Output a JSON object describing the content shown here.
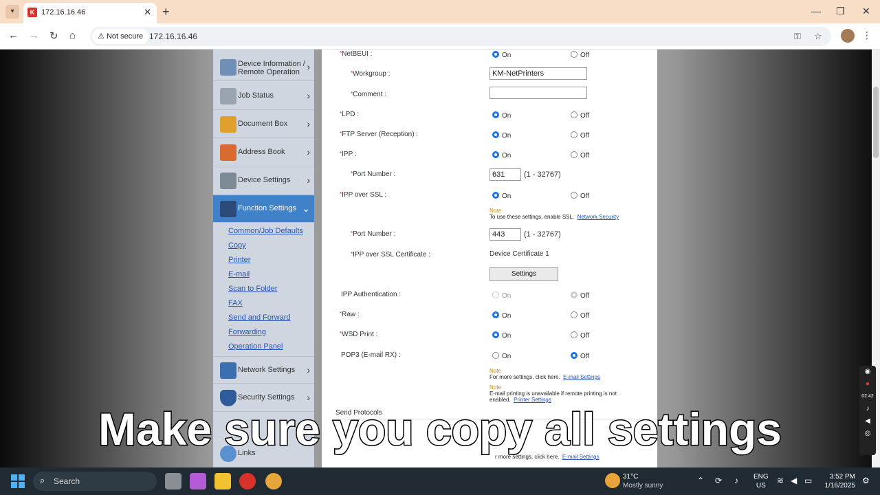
{
  "browser": {
    "tab_title": "172.16.16.46",
    "security_label": "Not secure",
    "url": "172.16.16.46"
  },
  "sidebar": {
    "items": [
      {
        "label_line1": "Device Information /",
        "label_line2": "Remote Operation",
        "icon": "device-info-icon"
      },
      {
        "label": "Job Status",
        "icon": "job-status-icon"
      },
      {
        "label": "Document Box",
        "icon": "document-box-icon"
      },
      {
        "label": "Address Book",
        "icon": "address-book-icon"
      },
      {
        "label": "Device Settings",
        "icon": "device-settings-icon"
      },
      {
        "label": "Function Settings",
        "icon": "function-settings-icon",
        "active": true
      },
      {
        "label": "Network Settings",
        "icon": "network-settings-icon"
      },
      {
        "label": "Security Settings",
        "icon": "security-settings-icon"
      },
      {
        "label": "Links",
        "icon": "links-icon"
      }
    ],
    "sub_items": [
      "Common/Job Defaults",
      "Copy",
      "Printer",
      "E-mail",
      "Scan to Folder",
      "FAX",
      "Send and Forward",
      "Forwarding",
      "Operation Panel"
    ]
  },
  "form": {
    "netbeui": {
      "label": "NetBEUI :",
      "on": "On",
      "off": "Off",
      "value": "On"
    },
    "workgroup": {
      "label": "Workgroup :",
      "value": "KM-NetPrinters"
    },
    "comment": {
      "label": "Comment :",
      "value": ""
    },
    "lpd": {
      "label": "LPD :",
      "on": "On",
      "off": "Off",
      "value": "On"
    },
    "ftp": {
      "label": "FTP Server (Reception) :",
      "on": "On",
      "off": "Off",
      "value": "On"
    },
    "ipp": {
      "label": "IPP :",
      "on": "On",
      "off": "Off",
      "value": "On"
    },
    "ipp_port": {
      "label": "Port Number :",
      "value": "631",
      "range": "(1 - 32767)"
    },
    "ipp_ssl": {
      "label": "IPP over SSL :",
      "on": "On",
      "off": "Off",
      "value": "On"
    },
    "ssl_note": {
      "heading": "Note",
      "text": "To use these settings, enable SSL.",
      "link": "Network Security"
    },
    "ssl_port": {
      "label": "Port Number :",
      "value": "443",
      "range": "(1 - 32767)"
    },
    "ssl_cert": {
      "label": "IPP over SSL Certificate :",
      "value": "Device Certificate 1",
      "button": "Settings"
    },
    "ipp_auth": {
      "label": "IPP Authentication :",
      "on": "On",
      "off": "Off",
      "value": "Off"
    },
    "raw": {
      "label": "Raw :",
      "on": "On",
      "off": "Off",
      "value": "On"
    },
    "wsd": {
      "label": "WSD Print :",
      "on": "On",
      "off": "Off",
      "value": "On"
    },
    "pop3": {
      "label": "POP3 (E-mail RX) :",
      "on": "On",
      "off": "Off",
      "value": "Off"
    },
    "pop3_note1": {
      "heading": "Note",
      "text": "For more settings, click here.",
      "link": "E-mail Settings"
    },
    "pop3_note2": {
      "heading": "Note",
      "text1": "E-mail printing is unavailable if remote printing is not",
      "text2": "enabled.",
      "link": "Printer Settings"
    },
    "send_protocols": "Send Protocols",
    "bottom_note": {
      "text": "r more settings, click here.",
      "link": "E-mail Settings"
    }
  },
  "caption": "Make sure you copy all settings",
  "recorder": {
    "time": "02:42"
  },
  "taskbar": {
    "search": "Search",
    "weather_temp": "31°C",
    "weather_desc": "Mostly sunny",
    "lang1": "ENG",
    "lang2": "US",
    "time": "3:52 PM",
    "date": "1/16/2025"
  }
}
